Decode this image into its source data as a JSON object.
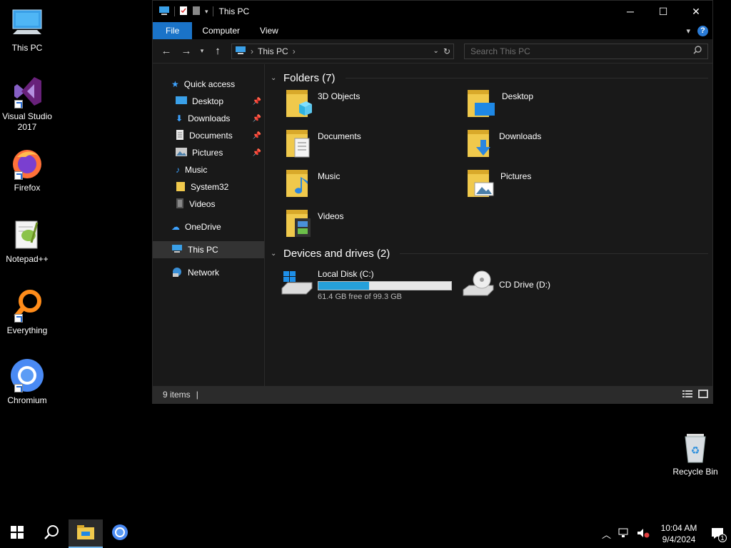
{
  "desktop": {
    "icons": [
      {
        "label": "This PC"
      },
      {
        "label": "Visual Studio 2017"
      },
      {
        "label": "Firefox"
      },
      {
        "label": "Notepad++"
      },
      {
        "label": "Everything"
      },
      {
        "label": "Chromium"
      },
      {
        "label": "Recycle Bin"
      }
    ]
  },
  "window": {
    "title": "This PC",
    "ribbon": {
      "tabs": [
        "File",
        "Computer",
        "View"
      ],
      "help": "?"
    },
    "address": {
      "location": "This PC"
    },
    "search": {
      "placeholder": "Search This PC"
    },
    "sidebar": {
      "quick_access": "Quick access",
      "items": [
        "Desktop",
        "Downloads",
        "Documents",
        "Pictures",
        "Music",
        "System32",
        "Videos"
      ],
      "onedrive": "OneDrive",
      "this_pc": "This PC",
      "network": "Network"
    },
    "folders_header": "Folders (7)",
    "folders": [
      "3D Objects",
      "Desktop",
      "Documents",
      "Downloads",
      "Music",
      "Pictures",
      "Videos"
    ],
    "devices_header": "Devices and drives (2)",
    "drives": [
      {
        "name": "Local Disk (C:)",
        "free_text": "61.4 GB free of 99.3 GB",
        "used_fraction": 0.38
      },
      {
        "name": "CD Drive (D:)"
      }
    ],
    "status": {
      "items": "9 items"
    }
  },
  "taskbar": {
    "time": "10:04 AM",
    "date": "9/4/2024",
    "notifications": "1"
  },
  "colors": {
    "accent": "#1a73c8",
    "drive_fill": "#26a0da",
    "folder": "#f0c94c"
  }
}
